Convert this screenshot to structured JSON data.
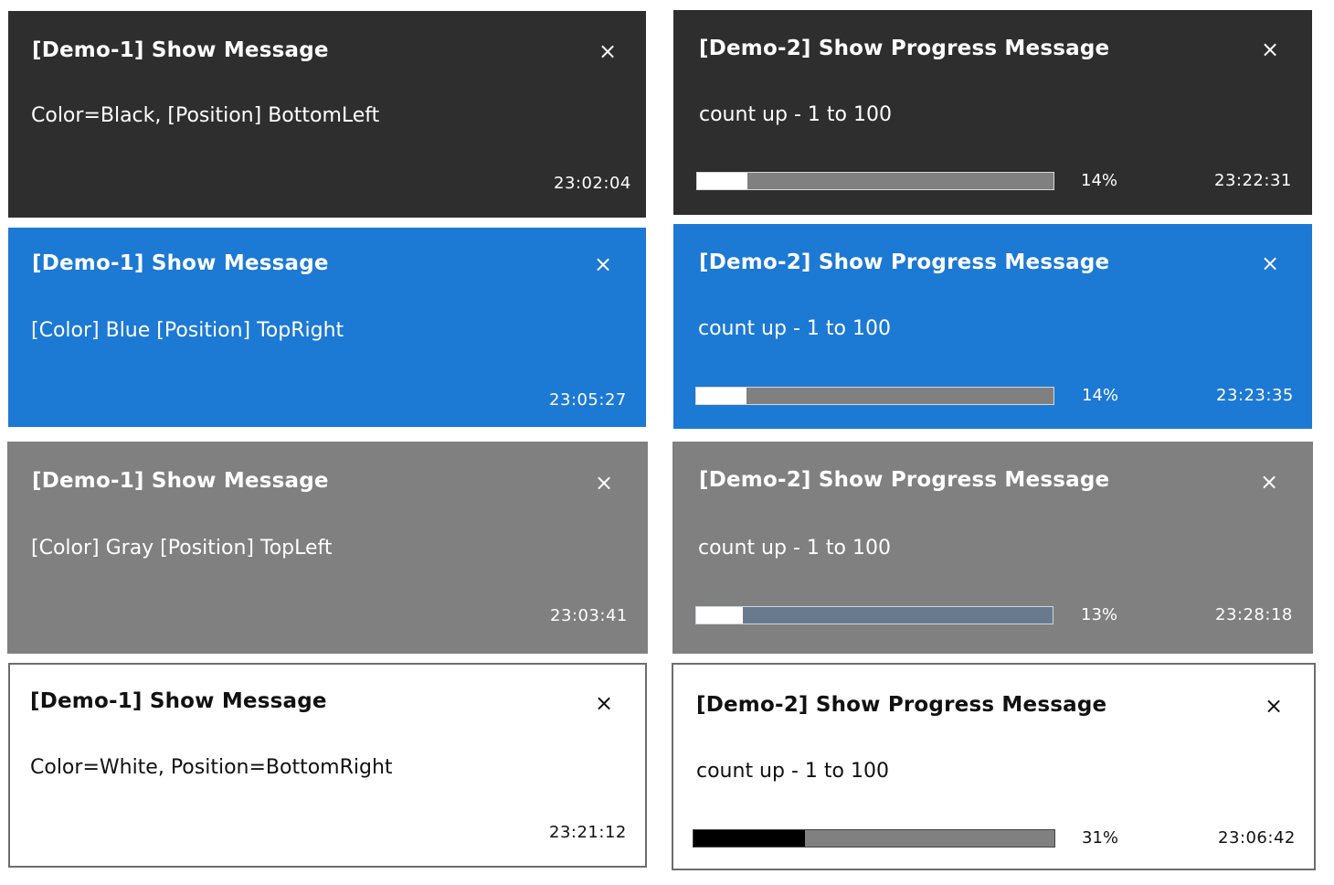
{
  "toasts": {
    "demo1_black": {
      "theme_color": "#2e2e2e",
      "title": "[Demo-1] Show Message",
      "close": "×",
      "message": "Color=Black,  [Position] BottomLeft",
      "time": "23:02:04"
    },
    "demo2_black": {
      "theme_color": "#2e2e2e",
      "title": "[Demo-2] Show Progress Message",
      "close": "×",
      "message": "count up - 1 to 100",
      "progress": 0.14,
      "progress_label": "14%",
      "time": "23:22:31"
    },
    "demo1_blue": {
      "theme_color": "#1c79d4",
      "title": "[Demo-1] Show Message",
      "close": "×",
      "message": "[Color] Blue  [Position] TopRight",
      "time": "23:05:27"
    },
    "demo2_blue": {
      "theme_color": "#1c79d4",
      "title": "[Demo-2] Show Progress Message",
      "close": "×",
      "message": "count up - 1 to 100",
      "progress": 0.14,
      "progress_label": "14%",
      "time": "23:23:35"
    },
    "demo1_gray": {
      "theme_color": "#808080",
      "title": "[Demo-1] Show Message",
      "close": "×",
      "message": "[Color] Gray  [Position] TopLeft",
      "time": "23:03:41"
    },
    "demo2_gray": {
      "theme_color": "#808080",
      "title": "[Demo-2] Show Progress Message",
      "close": "×",
      "message": "count up - 1 to 100",
      "progress": 0.13,
      "progress_label": "13%",
      "time": "23:28:18"
    },
    "demo1_white": {
      "theme_color": "#ffffff",
      "title": "[Demo-1] Show Message",
      "close": "×",
      "message": "Color=White,  Position=BottomRight",
      "time": "23:21:12"
    },
    "demo2_white": {
      "theme_color": "#ffffff",
      "title": "[Demo-2] Show Progress Message",
      "close": "×",
      "message": "count up - 1 to 100",
      "progress": 0.31,
      "progress_label": "31%",
      "time": "23:06:42"
    }
  }
}
